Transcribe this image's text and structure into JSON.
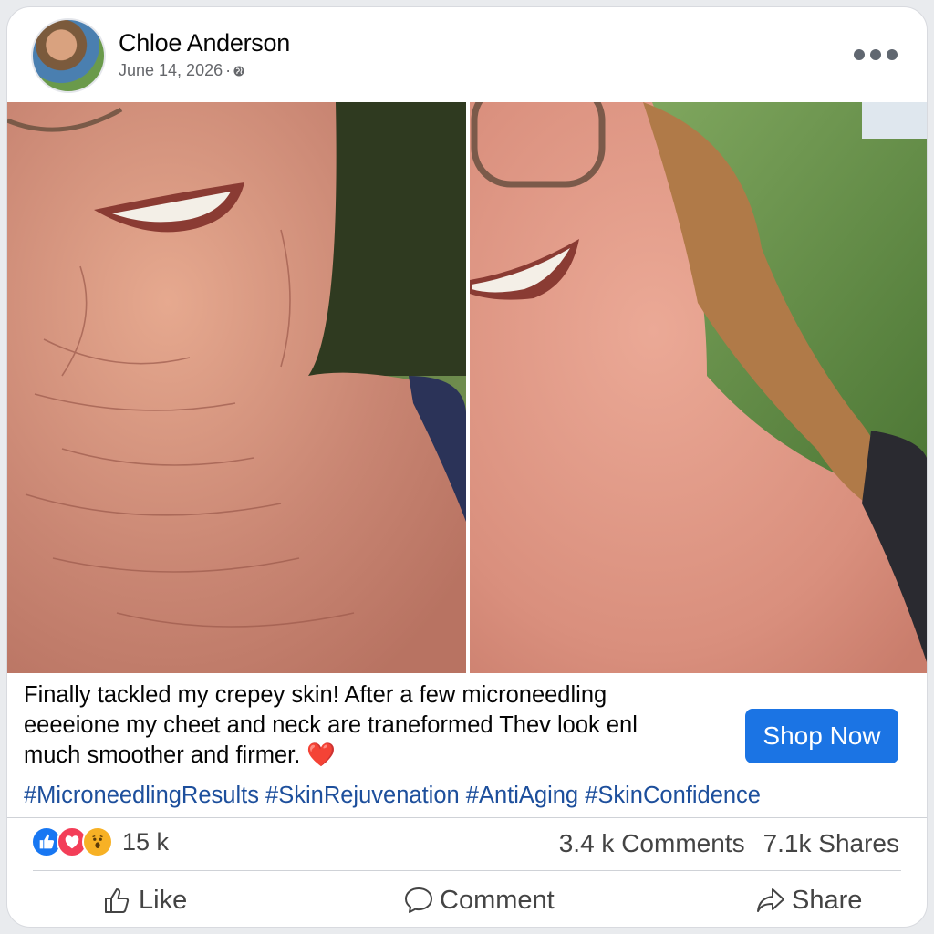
{
  "post": {
    "author": "Chloe Anderson",
    "date": "June 14, 2026",
    "date_sep": "·",
    "text_line1": "Finally tackled my crepey skin! After a few microneedling",
    "text_line2": "eeeeione my cheet and neck are traneformed Thev look enl",
    "text_line3": "much smoother and firmer. ❤️",
    "hashtags": "#MicroneedlingResults #SkinRejuvenation #AntiAging #SkinConfidence",
    "cta_label": "Shop Now"
  },
  "stats": {
    "reactions_count": "15 k",
    "comments": "3.4 k Comments",
    "shares": "7.1k Shares"
  },
  "actions": {
    "like": "Like",
    "comment": "Comment",
    "share": "Share"
  },
  "icons": {
    "reactions": [
      "like-reaction-icon",
      "love-reaction-icon",
      "wow-reaction-icon"
    ],
    "more": "more-options-icon",
    "privacy": "globe-icon"
  },
  "colors": {
    "cta": "#1b74e4",
    "hashtag": "#1d4f9c",
    "like_reaction": "#1877f2",
    "love_reaction": "#f33e58",
    "wow_reaction": "#f7b125"
  }
}
